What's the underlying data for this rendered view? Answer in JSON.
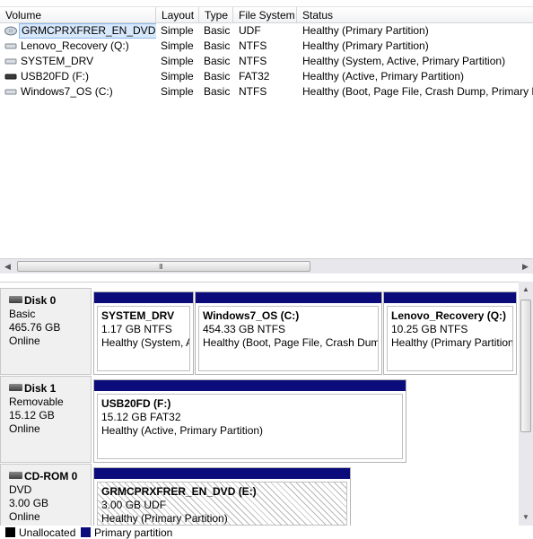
{
  "columns": {
    "volume": "Volume",
    "layout": "Layout",
    "type": "Type",
    "filesystem": "File System",
    "status": "Status"
  },
  "volumes": [
    {
      "name": "GRMCPRXFRER_EN_DVD (E:)",
      "layout": "Simple",
      "type": "Basic",
      "fs": "UDF",
      "status": "Healthy (Primary Partition)",
      "icon": "dvd-icon",
      "selected": true
    },
    {
      "name": "Lenovo_Recovery (Q:)",
      "layout": "Simple",
      "type": "Basic",
      "fs": "NTFS",
      "status": "Healthy (Primary Partition)",
      "icon": "volume-icon"
    },
    {
      "name": "SYSTEM_DRV",
      "layout": "Simple",
      "type": "Basic",
      "fs": "NTFS",
      "status": "Healthy (System, Active, Primary Partition)",
      "icon": "volume-icon"
    },
    {
      "name": "USB20FD (F:)",
      "layout": "Simple",
      "type": "Basic",
      "fs": "FAT32",
      "status": "Healthy (Active, Primary Partition)",
      "icon": "usb-drive-icon"
    },
    {
      "name": "Windows7_OS (C:)",
      "layout": "Simple",
      "type": "Basic",
      "fs": "NTFS",
      "status": "Healthy (Boot, Page File, Crash Dump, Primary Partition)",
      "icon": "volume-icon"
    }
  ],
  "hscroll": {
    "grip": "III"
  },
  "disks": [
    {
      "name": "Disk 0",
      "kind": "Basic",
      "size": "465.76 GB",
      "state": "Online",
      "icon": "hard-disk-icon",
      "partitions": [
        {
          "name": "SYSTEM_DRV",
          "size": "1.17 GB NTFS",
          "status": "Healthy (System, Active, Primary Partition)"
        },
        {
          "name": "Windows7_OS  (C:)",
          "size": "454.33 GB NTFS",
          "status": "Healthy (Boot, Page File, Crash Dump, Primary Partition)"
        },
        {
          "name": "Lenovo_Recovery  (Q:)",
          "size": "10.25 GB NTFS",
          "status": "Healthy (Primary Partition)"
        }
      ]
    },
    {
      "name": "Disk 1",
      "kind": "Removable",
      "size": "15.12 GB",
      "state": "Online",
      "icon": "removable-disk-icon",
      "partitions": [
        {
          "name": "USB20FD  (F:)",
          "size": "15.12 GB FAT32",
          "status": "Healthy (Active, Primary Partition)"
        }
      ]
    },
    {
      "name": "CD-ROM 0",
      "kind": "DVD",
      "size": "3.00 GB",
      "state": "Online",
      "icon": "cdrom-icon",
      "partitions": [
        {
          "name": "GRMCPRXFRER_EN_DVD  (E:)",
          "size": "3.00 GB UDF",
          "status": "Healthy (Primary Partition)"
        }
      ]
    }
  ],
  "legend": [
    {
      "label": "Unallocated",
      "color": "#000000"
    },
    {
      "label": "Primary partition",
      "color": "#0b0b7b"
    }
  ]
}
